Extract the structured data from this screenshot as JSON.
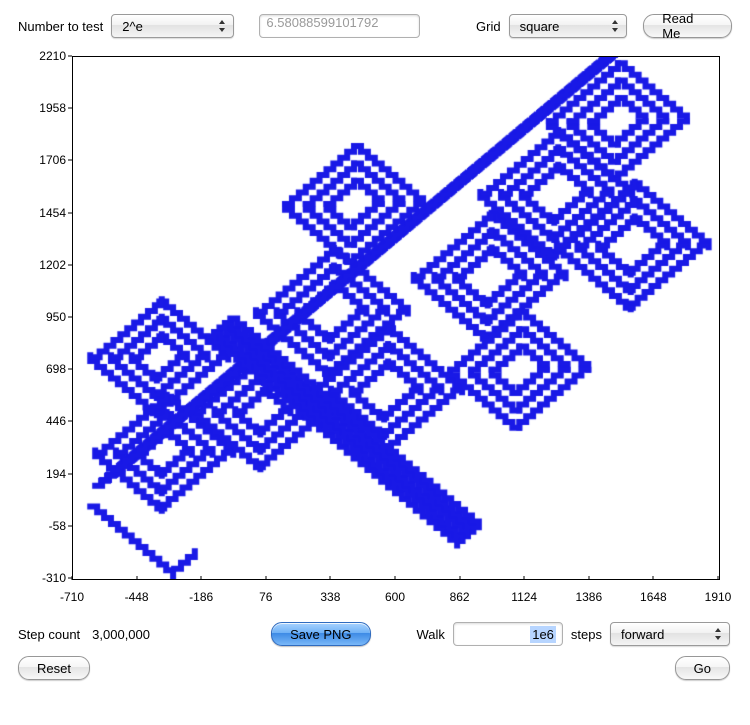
{
  "top": {
    "number_to_test_label": "Number to test",
    "number_select": "2^e",
    "number_value": "6.58088599101792",
    "grid_label": "Grid",
    "grid_select": "square",
    "readme_label": "Read Me"
  },
  "axes": {
    "yticks": [
      2210,
      1958,
      1706,
      1454,
      1202,
      950,
      698,
      446,
      194,
      -58,
      -310
    ],
    "xticks": [
      -710,
      -448,
      -186,
      76,
      338,
      600,
      862,
      1124,
      1386,
      1648,
      1910
    ],
    "xmin": -710,
    "xmax": 1910,
    "ymin": -310,
    "ymax": 2210
  },
  "bottom": {
    "step_count_label": "Step count",
    "step_count_value": "3,000,000",
    "save_png_label": "Save PNG",
    "walk_label": "Walk",
    "walk_value": "1e6",
    "steps_label": "steps",
    "direction_select": "forward",
    "reset_label": "Reset",
    "go_label": "Go"
  },
  "icons": {
    "updown": "updown"
  }
}
